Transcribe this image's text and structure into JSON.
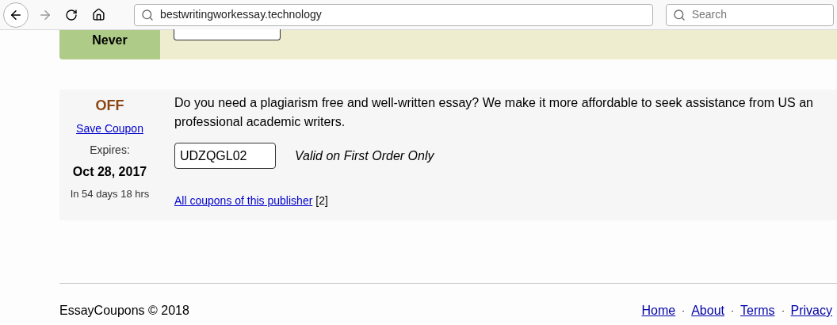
{
  "browser": {
    "url": "bestwritingworkessay.technology",
    "search_placeholder": "Search"
  },
  "previous_coupon": {
    "expiry": "Never"
  },
  "coupon": {
    "discount": "OFF",
    "save_link": "Save Coupon",
    "expires_label": "Expires:",
    "expires_date": "Oct 28, 2017",
    "remaining": "In 54 days 18 hrs",
    "description_lines": [
      "Do you need a plagiarism free and well-written essay? We make it more affordable to seek assistance from US an",
      "professional academic writers."
    ],
    "code": "UDZQGL02",
    "condition": "Valid on First Order Only",
    "publisher_link": "All coupons of this publisher",
    "publisher_count": "[2]"
  },
  "footer": {
    "copyright": "EssayCoupons © 2018",
    "links": [
      "Home",
      "About",
      "Terms",
      "Privacy"
    ]
  }
}
